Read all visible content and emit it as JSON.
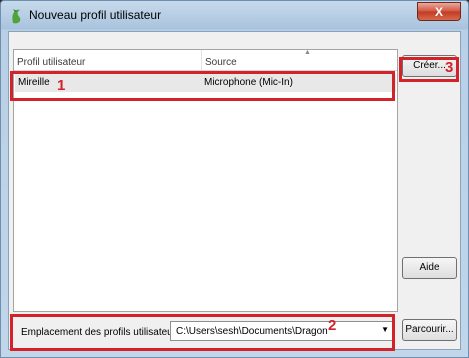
{
  "window": {
    "title": "Nouveau profil utilisateur",
    "close_label": "X"
  },
  "list": {
    "columns": [
      "Profil utilisateur",
      "Source"
    ],
    "rows": [
      {
        "profile": "Mireille",
        "source": "Microphone (Mic-In)"
      }
    ]
  },
  "buttons": {
    "create": "Créer...",
    "help": "Aide",
    "browse": "Parcourir..."
  },
  "location": {
    "label": "Emplacement des profils utilisateur :",
    "path": "C:\\Users\\sesh\\Documents\\Dragon"
  },
  "annotations": [
    "1",
    "2",
    "3"
  ],
  "colors": {
    "annotation": "#d2232a",
    "title_bar": "#b9cfe5",
    "close_button": "#c23a22"
  }
}
